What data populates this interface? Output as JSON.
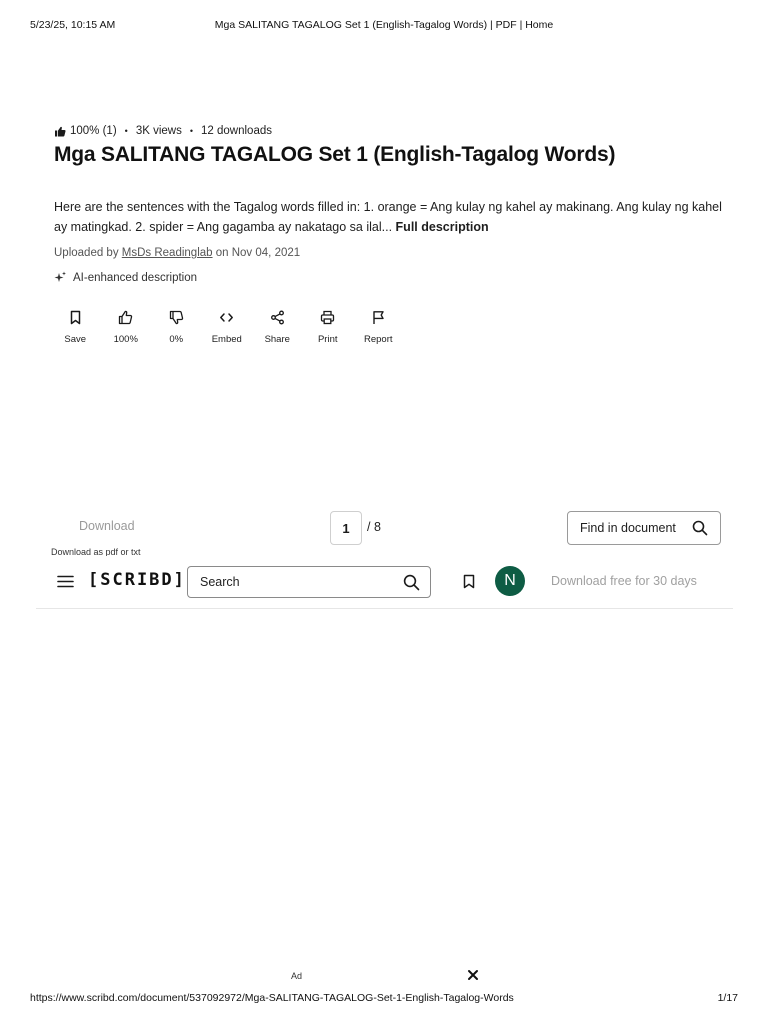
{
  "print_header": {
    "datetime": "5/23/25, 10:15 AM",
    "title": "Mga SALITANG TAGALOG Set 1 (English-Tagalog Words) | PDF | Home"
  },
  "stats": {
    "rating": "100% (1)",
    "views": "3K views",
    "downloads": "12 downloads"
  },
  "document": {
    "title": "Mga SALITANG TAGALOG Set 1 (English-Tagalog Words)",
    "description": "Here are the sentences with the Tagalog words filled in: 1. orange = Ang kulay ng kahel ay makinang. Ang kulay ng kahel ay matingkad. 2. spider = Ang gagamba ay nakatago sa ilal...",
    "full_description_link": "Full description",
    "uploaded_prefix": "Uploaded by",
    "uploader": "MsDs Readinglab",
    "uploaded_suffix": "on Nov 04, 2021",
    "ai_label": "AI-enhanced description"
  },
  "actions": [
    {
      "label": "Save",
      "icon": "bookmark-icon"
    },
    {
      "label": "100%",
      "icon": "thumbs-up-icon"
    },
    {
      "label": "0%",
      "icon": "thumbs-down-icon"
    },
    {
      "label": "Embed",
      "icon": "code-icon"
    },
    {
      "label": "Share",
      "icon": "share-icon"
    },
    {
      "label": "Print",
      "icon": "printer-icon"
    },
    {
      "label": "Report",
      "icon": "flag-icon"
    }
  ],
  "toolbar": {
    "download_label": "Download",
    "download_sub": "Download as pdf or txt",
    "current_page": "1",
    "total_pages": "/ 8",
    "find_label": "Find in document"
  },
  "nav": {
    "logo": "[SCRIBD]",
    "search_placeholder": "Search",
    "avatar_initial": "N",
    "download_free": "Download free for 30 days"
  },
  "ad": {
    "label": "Ad"
  },
  "print_footer": {
    "url": "https://www.scribd.com/document/537092972/Mga-SALITANG-TAGALOG-Set-1-English-Tagalog-Words",
    "page": "1/17"
  },
  "colors": {
    "avatar_bg": "#0e5c44",
    "muted_text": "#9a9a9a"
  }
}
